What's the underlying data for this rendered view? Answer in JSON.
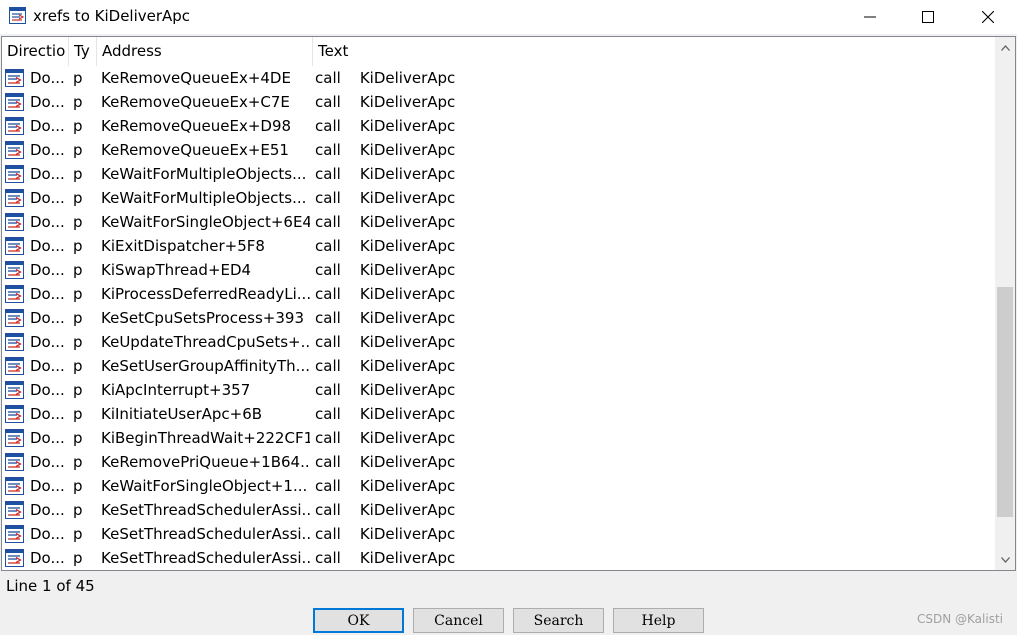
{
  "window": {
    "title": "xrefs to KiDeliverApc",
    "icon": "xrefs-window-icon",
    "controls": [
      "minimize-icon",
      "maximize-icon",
      "close-icon"
    ]
  },
  "list": {
    "columns": [
      "Directio",
      "Ty",
      "Address",
      "Text"
    ],
    "rows": [
      {
        "direction": "Do...",
        "type": "p",
        "address": "KeRemoveQueueEx+4DE",
        "text": "call    KiDeliverApc"
      },
      {
        "direction": "Do...",
        "type": "p",
        "address": "KeRemoveQueueEx+C7E",
        "text": "call    KiDeliverApc"
      },
      {
        "direction": "Do...",
        "type": "p",
        "address": "KeRemoveQueueEx+D98",
        "text": "call    KiDeliverApc"
      },
      {
        "direction": "Do...",
        "type": "p",
        "address": "KeRemoveQueueEx+E51",
        "text": "call    KiDeliverApc"
      },
      {
        "direction": "Do...",
        "type": "p",
        "address": "KeWaitForMultipleObjects...",
        "text": "call    KiDeliverApc"
      },
      {
        "direction": "Do...",
        "type": "p",
        "address": "KeWaitForMultipleObjects...",
        "text": "call    KiDeliverApc"
      },
      {
        "direction": "Do...",
        "type": "p",
        "address": "KeWaitForSingleObject+6E4",
        "text": "call    KiDeliverApc"
      },
      {
        "direction": "Do...",
        "type": "p",
        "address": "KiExitDispatcher+5F8",
        "text": "call    KiDeliverApc"
      },
      {
        "direction": "Do...",
        "type": "p",
        "address": "KiSwapThread+ED4",
        "text": "call    KiDeliverApc"
      },
      {
        "direction": "Do...",
        "type": "p",
        "address": "KiProcessDeferredReadyLi...",
        "text": "call    KiDeliverApc"
      },
      {
        "direction": "Do...",
        "type": "p",
        "address": "KeSetCpuSetsProcess+393",
        "text": "call    KiDeliverApc"
      },
      {
        "direction": "Do...",
        "type": "p",
        "address": "KeUpdateThreadCpuSets+...",
        "text": "call    KiDeliverApc"
      },
      {
        "direction": "Do...",
        "type": "p",
        "address": "KeSetUserGroupAffinityTh...",
        "text": "call    KiDeliverApc"
      },
      {
        "direction": "Do...",
        "type": "p",
        "address": "KiApcInterrupt+357",
        "text": "call    KiDeliverApc"
      },
      {
        "direction": "Do...",
        "type": "p",
        "address": "KiInitiateUserApc+6B",
        "text": "call    KiDeliverApc"
      },
      {
        "direction": "Do...",
        "type": "p",
        "address": "KiBeginThreadWait+222CF1",
        "text": "call    KiDeliverApc"
      },
      {
        "direction": "Do...",
        "type": "p",
        "address": "KeRemovePriQueue+1B64...",
        "text": "call    KiDeliverApc"
      },
      {
        "direction": "Do...",
        "type": "p",
        "address": "KeWaitForSingleObject+1...",
        "text": "call    KiDeliverApc"
      },
      {
        "direction": "Do...",
        "type": "p",
        "address": "KeSetThreadSchedulerAssi...",
        "text": "call    KiDeliverApc"
      },
      {
        "direction": "Do...",
        "type": "p",
        "address": "KeSetThreadSchedulerAssi...",
        "text": "call    KiDeliverApc"
      },
      {
        "direction": "Do...",
        "type": "p",
        "address": "KeSetThreadSchedulerAssi...",
        "text": "call    KiDeliverApc"
      }
    ],
    "row_icon": "xref-down-icon",
    "scroll": {
      "up_icon": "scroll-up-icon",
      "down_icon": "scroll-down-icon"
    }
  },
  "status": {
    "line": "Line 1 of 45"
  },
  "buttons": {
    "ok": "OK",
    "cancel": "Cancel",
    "search": "Search",
    "help": "Help"
  },
  "watermark": "CSDN @Kalisti",
  "colors": {
    "accent": "#0078d7",
    "icon_blue": "#1f4fa0",
    "icon_red": "#d03030",
    "thumb": "#cdcdcd"
  }
}
